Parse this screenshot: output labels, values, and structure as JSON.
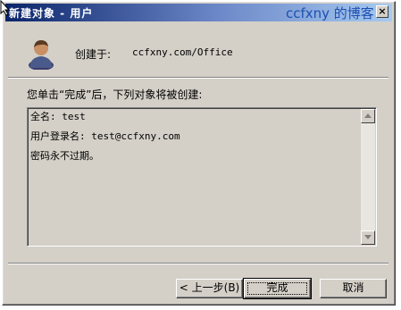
{
  "window": {
    "title": "新建对象 - 用户",
    "watermark": "ccfxny 的博客",
    "close_glyph": "×"
  },
  "header": {
    "create_in_label": "创建于:",
    "create_in_path": "ccfxny.com/Office"
  },
  "main": {
    "instruction": "您单击“完成”后，下列对象将被创建:",
    "summary": [
      "全名: test",
      "用户登录名: test@ccfxny.com",
      "密码永不过期。"
    ]
  },
  "buttons": {
    "back": "< 上一步(B)",
    "finish": "完成",
    "cancel": "取消"
  }
}
